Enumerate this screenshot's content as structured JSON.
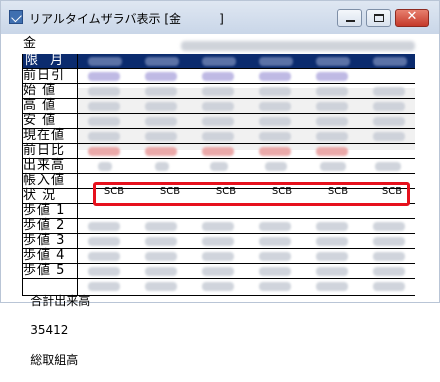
{
  "window": {
    "title": "リアルタイムザラバ表示 [金          ]",
    "close_label": "✕"
  },
  "table": {
    "top_label": "金",
    "header_label": "限 月",
    "row_labels": [
      "前日引",
      "始 値",
      "高 値",
      "安 値",
      "現在値",
      "前日比",
      "出来高",
      "帳入値",
      "状 況",
      "歩値 1",
      "歩値 2",
      "歩値 3",
      "歩値 4",
      "歩値 5"
    ],
    "status_values": [
      "SCB",
      "SCB",
      "SCB",
      "SCB",
      "SCB",
      "SCB"
    ]
  },
  "footer": {
    "total_volume_label": "合計出来高",
    "total_volume_value": "35412",
    "open_interest_label": "総取組高"
  },
  "colors": {
    "header_bg": "#0b2b6e",
    "highlight": "#e6101c"
  }
}
